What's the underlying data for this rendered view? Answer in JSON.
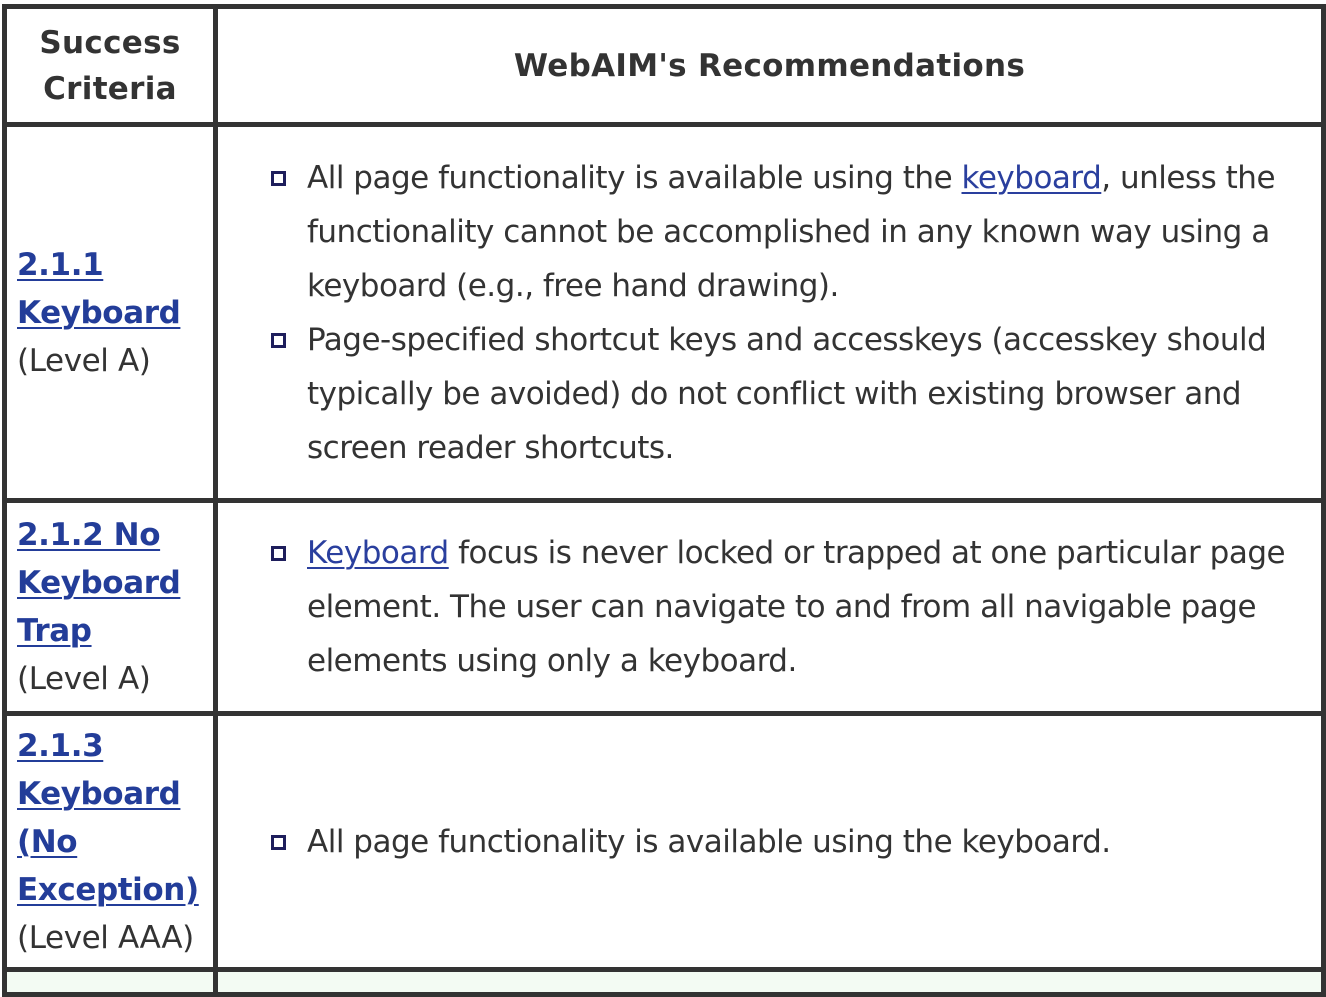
{
  "table": {
    "headers": {
      "criteria": "Success Criteria",
      "recommendations": "WebAIM's Recommendations"
    },
    "rows": [
      {
        "criterion_link": "2.1.1 Keyboard",
        "level": "(Level A)",
        "recommendations": [
          {
            "prefix": "All page functionality is available using the ",
            "link": "keyboard",
            "suffix": ", unless the functionality cannot be accomplished in any known way using a keyboard (e.g., free hand drawing)."
          },
          {
            "prefix": "Page-specified shortcut keys and accesskeys (accesskey should typically be avoided) do not conflict with existing browser and screen reader shortcuts.",
            "link": "",
            "suffix": ""
          }
        ]
      },
      {
        "criterion_link": "2.1.2 No Keyboard Trap",
        "level": "(Level A)",
        "recommendations": [
          {
            "prefix": "",
            "link": "Keyboard",
            "suffix": " focus is never locked or trapped at one particular page element. The user can navigate to and from all navigable page elements using only a keyboard."
          }
        ]
      },
      {
        "criterion_link": "2.1.3 Keyboard (No Exception)",
        "level": "(Level AAA)",
        "recommendations": [
          {
            "prefix": "All page functionality is available using the keyboard.",
            "link": "",
            "suffix": ""
          }
        ]
      }
    ]
  },
  "colors": {
    "border": "#333333",
    "text": "#333333",
    "link": "#233d99",
    "bullet_border": "#1e1e5c",
    "next_row_tint": "#f3fbf3"
  },
  "icons": {
    "bullet": "square-bullet-icon"
  }
}
